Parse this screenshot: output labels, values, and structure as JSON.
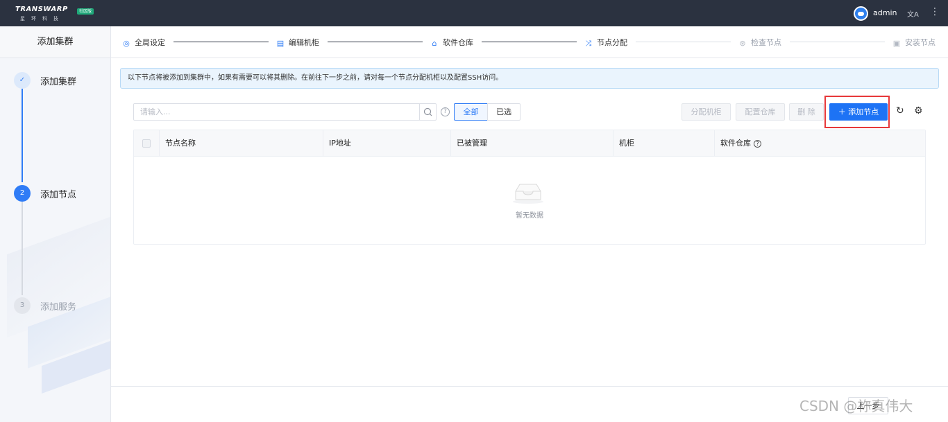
{
  "app": {
    "logo_text": "TRANSWARP",
    "logo_badge": "社区版",
    "logo_sub": "星环科技"
  },
  "header": {
    "username": "admin",
    "lang_glyph": "文A",
    "more_glyph": "⋮"
  },
  "sidebar": {
    "title": "添加集群",
    "steps": [
      {
        "index": "✓",
        "label": "添加集群",
        "state": "done"
      },
      {
        "index": "2",
        "label": "添加节点",
        "state": "active"
      },
      {
        "index": "3",
        "label": "添加服务",
        "state": "wait"
      }
    ]
  },
  "wizard": {
    "steps": [
      {
        "label": "全局设定",
        "icon": "globe-icon",
        "state": "done"
      },
      {
        "label": "编辑机柜",
        "icon": "cabinet-icon",
        "state": "done"
      },
      {
        "label": "软件仓库",
        "icon": "home-icon",
        "state": "done"
      },
      {
        "label": "节点分配",
        "icon": "shuffle-icon",
        "state": "active"
      },
      {
        "label": "检查节点",
        "icon": "check-node-icon",
        "state": "disabled"
      },
      {
        "label": "安装节点",
        "icon": "install-icon",
        "state": "disabled"
      }
    ]
  },
  "info": {
    "text": "以下节点将被添加到集群中，如果有需要可以将其删除。在前往下一步之前，请对每一个节点分配机柜以及配置SSH访问。"
  },
  "toolbar": {
    "search_placeholder": "请输入...",
    "filter_all": "全部",
    "filter_selected": "已选",
    "assign_rack": "分配机柜",
    "config_repo": "配置仓库",
    "delete": "删 除",
    "add_node": "＋ 添加节点"
  },
  "table": {
    "columns": [
      "节点名称",
      "IP地址",
      "已被管理",
      "机柜",
      "软件仓库"
    ],
    "empty_text": "暂无数据"
  },
  "footer": {
    "prev": "上一步"
  },
  "watermark": "CSDN @祢真伟大",
  "colors": {
    "primary": "#1d73f5",
    "topbar": "#2b3240",
    "highlight": "#e7383a"
  }
}
